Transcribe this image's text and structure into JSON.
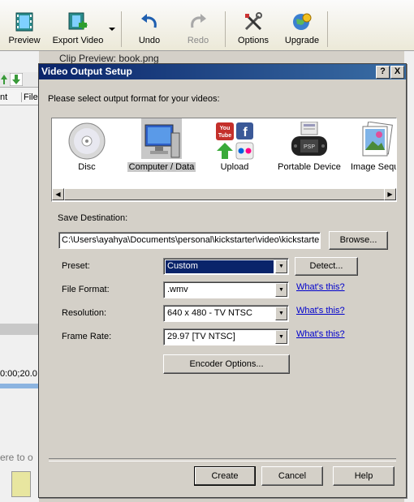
{
  "toolbar": {
    "preview": "Preview",
    "export_video": "Export Video",
    "undo": "Undo",
    "redo": "Redo",
    "options": "Options",
    "upgrade": "Upgrade"
  },
  "background": {
    "clip_preview": "Clip Preview: book.png",
    "col_nt": "nt",
    "col_file": "File",
    "timecode": "0:00;20.0",
    "drag_hint": "ere to o"
  },
  "dialog": {
    "title": "Video Output Setup",
    "help_btn": "?",
    "close_btn": "X",
    "instruction": "Please select output format for your videos:",
    "formats": [
      {
        "label": "Disc",
        "icon": "disc-icon"
      },
      {
        "label": "Computer / Data",
        "icon": "computer-icon",
        "selected": true
      },
      {
        "label": "Upload",
        "icon": "upload-icon"
      },
      {
        "label": "Portable Device",
        "icon": "psp-icon"
      },
      {
        "label": "Image Sequ",
        "icon": "image-sequence-icon"
      }
    ],
    "save_destination_label": "Save Destination:",
    "save_destination_value": "C:\\Users\\ayahya\\Documents\\personal\\kickstarter\\video\\kickstarter",
    "browse": "Browse...",
    "preset_label": "Preset:",
    "preset_value": "Custom",
    "detect": "Detect...",
    "file_format_label": "File Format:",
    "file_format_value": ".wmv",
    "resolution_label": "Resolution:",
    "resolution_value": "640 x 480 - TV NTSC",
    "frame_rate_label": "Frame Rate:",
    "frame_rate_value": "29.97 [TV NTSC]",
    "whats_this": "What's this?",
    "encoder_options": "Encoder Options...",
    "create": "Create",
    "cancel": "Cancel",
    "help": "Help"
  },
  "colors": {
    "title_start": "#0a246a",
    "title_end": "#3a6ea5",
    "selection": "#0a246a",
    "link": "#0000cc"
  }
}
